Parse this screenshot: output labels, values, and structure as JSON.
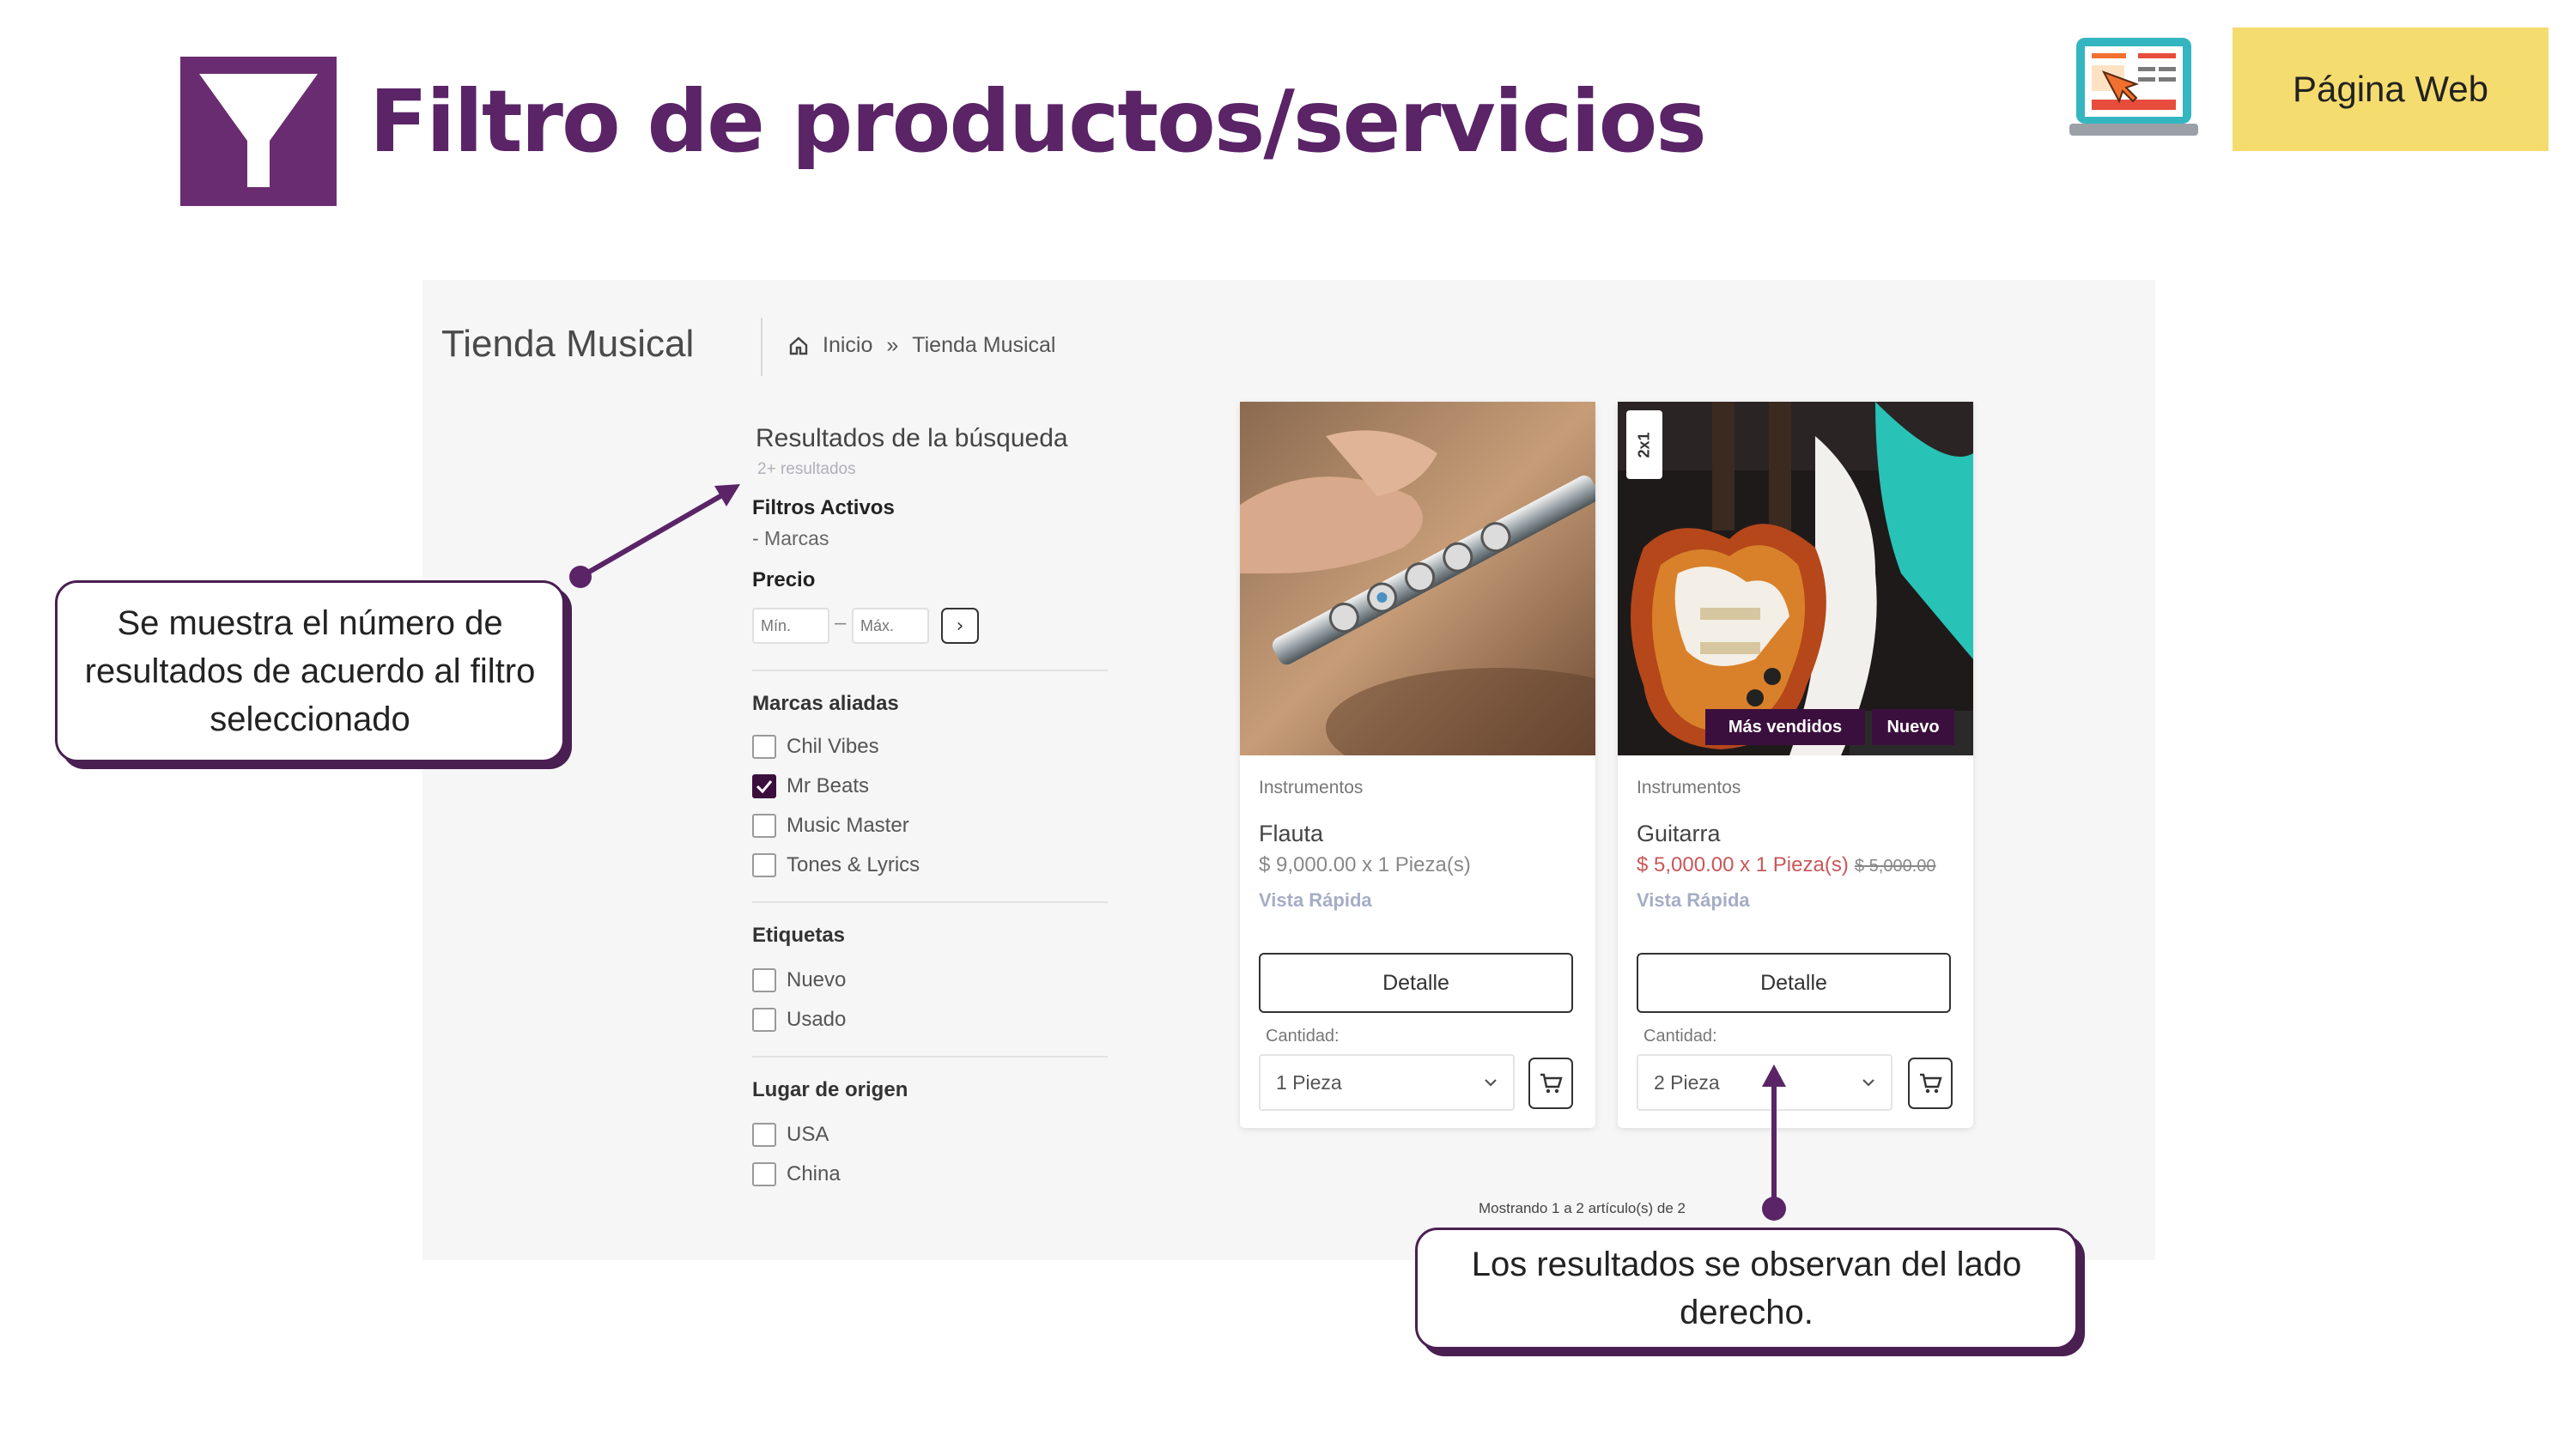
{
  "header": {
    "title": "Filtro de productos/servicios",
    "badge": "Página Web",
    "icons": [
      "filter-icon",
      "web-page-icon"
    ]
  },
  "shop": {
    "title": "Tienda Musical",
    "breadcrumb": {
      "home_icon": "home-icon",
      "home": "Inicio",
      "separator": "»",
      "current": "Tienda Musical"
    }
  },
  "sidebar": {
    "results_title": "Resultados de la búsqueda",
    "results_count": "2+ resultados",
    "active_filters_label": "Filtros Activos",
    "active_filter_item": "- Marcas",
    "price": {
      "label": "Precio",
      "min_placeholder": "Mín.",
      "max_placeholder": "Máx.",
      "dash": "–",
      "go": "›"
    },
    "brands": {
      "label": "Marcas aliadas",
      "items": [
        {
          "label": "Chil Vibes",
          "checked": false
        },
        {
          "label": "Mr Beats",
          "checked": true
        },
        {
          "label": "Music Master",
          "checked": false
        },
        {
          "label": "Tones & Lyrics",
          "checked": false
        }
      ]
    },
    "tags": {
      "label": "Etiquetas",
      "items": [
        {
          "label": "Nuevo",
          "checked": false
        },
        {
          "label": "Usado",
          "checked": false
        }
      ]
    },
    "origin": {
      "label": "Lugar de origen",
      "items": [
        {
          "label": "USA",
          "checked": false
        },
        {
          "label": "China",
          "checked": false
        }
      ]
    }
  },
  "products": [
    {
      "category": "Instrumentos",
      "name": "Flauta",
      "price": "$ 9,000.00 x 1 Pieza(s)",
      "old_price": "",
      "quick_view": "Vista Rápida",
      "detail_label": "Detalle",
      "qty_label": "Cantidad:",
      "qty_value": "1 Pieza",
      "badges": []
    },
    {
      "category": "Instrumentos",
      "name": "Guitarra",
      "price": "$ 5,000.00 x 1 Pieza(s)",
      "old_price": "$ 5,000.00",
      "quick_view": "Vista Rápida",
      "detail_label": "Detalle",
      "qty_label": "Cantidad:",
      "qty_value": "2 Pieza",
      "badges": [
        "Más vendidos",
        "Nuevo"
      ],
      "promo": "2x1"
    }
  ],
  "pagination": "Mostrando 1 a 2 artículo(s) de 2",
  "callouts": {
    "left": "Se muestra el número de resultados de acuerdo al filtro seleccionado",
    "right": "Los resultados se observan del lado derecho."
  },
  "colors": {
    "brand_purple": "#5a2467",
    "dark_purple": "#3b0f3d",
    "badge_yellow": "#f5dc6e",
    "sale_red": "#c95658",
    "quick_view": "#a5adc6"
  }
}
